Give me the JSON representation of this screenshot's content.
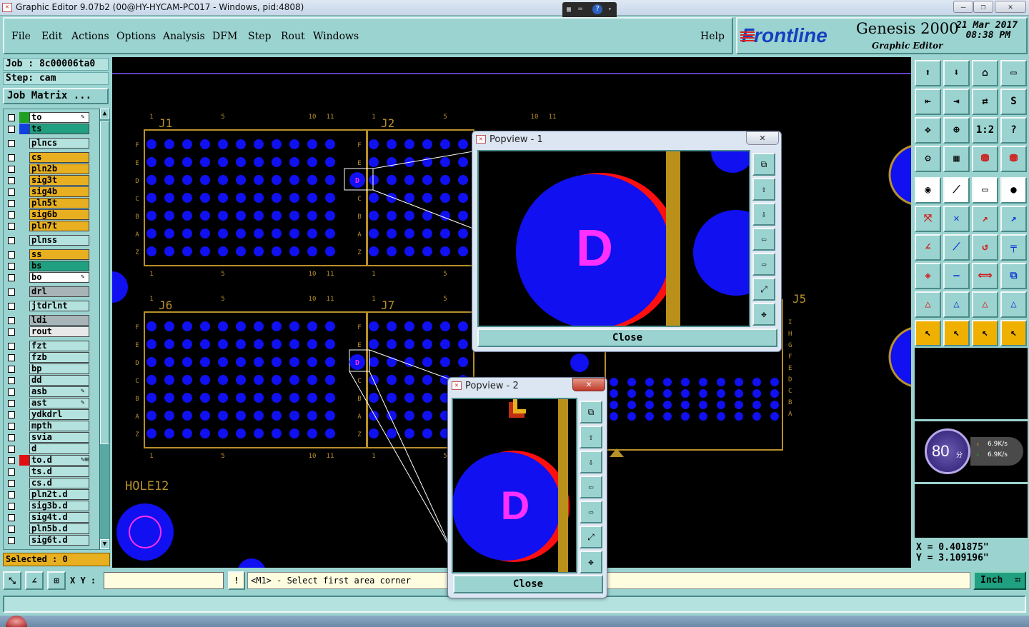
{
  "window": {
    "title": "Graphic Editor 9.07b2 (00@HY-HYCAM-PC017 - Windows, pid:4808)",
    "app_icon": "app-icon",
    "controls": {
      "minimize": "—",
      "maximize": "❐",
      "close": "✕"
    }
  },
  "menu": {
    "items": [
      "File",
      "Edit",
      "Actions",
      "Options",
      "Analysis",
      "DFM",
      "Step",
      "Rout",
      "Windows"
    ],
    "help": "Help"
  },
  "brand": {
    "logo": "Frontline",
    "product": "Genesis 2000",
    "subtitle": "Graphic Editor",
    "date": "21 Mar 2017",
    "time": "08:38 PM"
  },
  "job": {
    "label": "Job : 8c00006ta0",
    "step": "Step: cam",
    "matrix_button": "Job Matrix ..."
  },
  "layers": [
    {
      "name": "to",
      "color": "#ffffff",
      "swatch": "#20a020",
      "flag": "✎"
    },
    {
      "name": "ts",
      "color": "#20a080",
      "swatch": "#1040e0",
      "flag": ""
    },
    {
      "name": "plncs",
      "color": "#b4e2df",
      "swatch": "",
      "flag": ""
    },
    {
      "name": "cs",
      "color": "#e8b020",
      "swatch": "",
      "flag": ""
    },
    {
      "name": "pln2b",
      "color": "#e8b020",
      "swatch": "",
      "flag": ""
    },
    {
      "name": "sig3t",
      "color": "#e8b020",
      "swatch": "",
      "flag": ""
    },
    {
      "name": "sig4b",
      "color": "#e8b020",
      "swatch": "",
      "flag": ""
    },
    {
      "name": "pln5t",
      "color": "#e8b020",
      "swatch": "",
      "flag": ""
    },
    {
      "name": "sig6b",
      "color": "#e8b020",
      "swatch": "",
      "flag": ""
    },
    {
      "name": "pln7t",
      "color": "#e8b020",
      "swatch": "",
      "flag": ""
    },
    {
      "name": "plnss",
      "color": "#b4e2df",
      "swatch": "",
      "flag": ""
    },
    {
      "name": "ss",
      "color": "#e8b020",
      "swatch": "",
      "flag": ""
    },
    {
      "name": "bs",
      "color": "#20a080",
      "swatch": "",
      "flag": ""
    },
    {
      "name": "bo",
      "color": "#ffffff",
      "swatch": "",
      "flag": "✎"
    },
    {
      "name": "drl",
      "color": "#a8b4b8",
      "swatch": "",
      "flag": ""
    },
    {
      "name": "jtdrlnt",
      "color": "#b4e2df",
      "swatch": "",
      "flag": ""
    },
    {
      "name": "ldi",
      "color": "#a8b4b8",
      "swatch": "",
      "flag": ""
    },
    {
      "name": "rout",
      "color": "#e8e8e8",
      "swatch": "",
      "flag": ""
    },
    {
      "name": "fzt",
      "color": "#b4e2df",
      "swatch": "",
      "flag": ""
    },
    {
      "name": "fzb",
      "color": "#b4e2df",
      "swatch": "",
      "flag": ""
    },
    {
      "name": "bp",
      "color": "#b4e2df",
      "swatch": "",
      "flag": ""
    },
    {
      "name": "dd",
      "color": "#b4e2df",
      "swatch": "",
      "flag": ""
    },
    {
      "name": "asb",
      "color": "#b4e2df",
      "swatch": "",
      "flag": "✎"
    },
    {
      "name": "ast",
      "color": "#b4e2df",
      "swatch": "",
      "flag": "✎"
    },
    {
      "name": "ydkdrl",
      "color": "#b4e2df",
      "swatch": "",
      "flag": ""
    },
    {
      "name": "mpth",
      "color": "#b4e2df",
      "swatch": "",
      "flag": ""
    },
    {
      "name": "svia",
      "color": "#b4e2df",
      "swatch": "",
      "flag": ""
    },
    {
      "name": "d",
      "color": "#b4e2df",
      "swatch": "",
      "flag": ""
    },
    {
      "name": "to.d",
      "color": "#b4e2df",
      "swatch": "#e01010",
      "flag": "✎⊞"
    },
    {
      "name": "ts.d",
      "color": "#b4e2df",
      "swatch": "",
      "flag": ""
    },
    {
      "name": "cs.d",
      "color": "#b4e2df",
      "swatch": "",
      "flag": ""
    },
    {
      "name": "pln2t.d",
      "color": "#b4e2df",
      "swatch": "",
      "flag": ""
    },
    {
      "name": "sig3b.d",
      "color": "#b4e2df",
      "swatch": "",
      "flag": ""
    },
    {
      "name": "sig4t.d",
      "color": "#b4e2df",
      "swatch": "",
      "flag": ""
    },
    {
      "name": "pln5b.d",
      "color": "#b4e2df",
      "swatch": "",
      "flag": ""
    },
    {
      "name": "sig6t.d",
      "color": "#b4e2df",
      "swatch": "",
      "flag": ""
    }
  ],
  "selected": "Selected : 0",
  "canvas": {
    "components": [
      "J1",
      "J2",
      "J6",
      "J7",
      "J5"
    ],
    "hole_label": "HOLE12",
    "row_labels": [
      "F",
      "E",
      "D",
      "C",
      "B",
      "A",
      "Z"
    ],
    "row_labels_j5": [
      "I",
      "H",
      "G",
      "F",
      "E",
      "D",
      "C",
      "B",
      "A"
    ],
    "col_labels": [
      "1",
      "5",
      "10",
      "11"
    ],
    "pad_letter": "D",
    "pad_color": "#1010f0",
    "outline_color": "#b8902a",
    "highlight_color": "#ff30ff"
  },
  "popups": [
    {
      "title": "Popview - 1",
      "close": "Close",
      "x": "✕"
    },
    {
      "title": "Popview - 2",
      "close": "Close",
      "x": "✕"
    }
  ],
  "popup_tools": [
    "⧉",
    "⇧",
    "⇩",
    "⇦",
    "⇨",
    "⤢",
    "✥"
  ],
  "toolbar": {
    "rows": [
      [
        "⬆",
        "⬇",
        "⌂",
        "▭"
      ],
      [
        "⇤",
        "⇥",
        "⇄",
        "S"
      ],
      [
        "✥",
        "⊕",
        "1:2",
        "?"
      ],
      [
        "⚙",
        "▦",
        "⛃",
        "⛃"
      ],
      [
        "◉",
        "⟋",
        "▭",
        "●"
      ],
      [
        "⤧",
        "✕",
        "↗",
        "↗"
      ],
      [
        "∠",
        "⟋",
        "↺",
        "╤"
      ],
      [
        "◈",
        "—",
        "⟺",
        "⧉"
      ],
      [
        "△",
        "△",
        "△",
        "△"
      ],
      [
        "↖",
        "↖",
        "↖",
        "↖"
      ]
    ]
  },
  "monitor": {
    "score": "80",
    "unit": "分",
    "up": "6.9K/s",
    "down": "6.9K/s"
  },
  "coords": {
    "x": "X = 0.401875\"",
    "y": "Y = 3.109196\""
  },
  "command": {
    "xy_label": "X Y :",
    "xy_value": "",
    "prompt": "<M1> - Select first area corner",
    "unit": "Inch",
    "alert": "!"
  }
}
